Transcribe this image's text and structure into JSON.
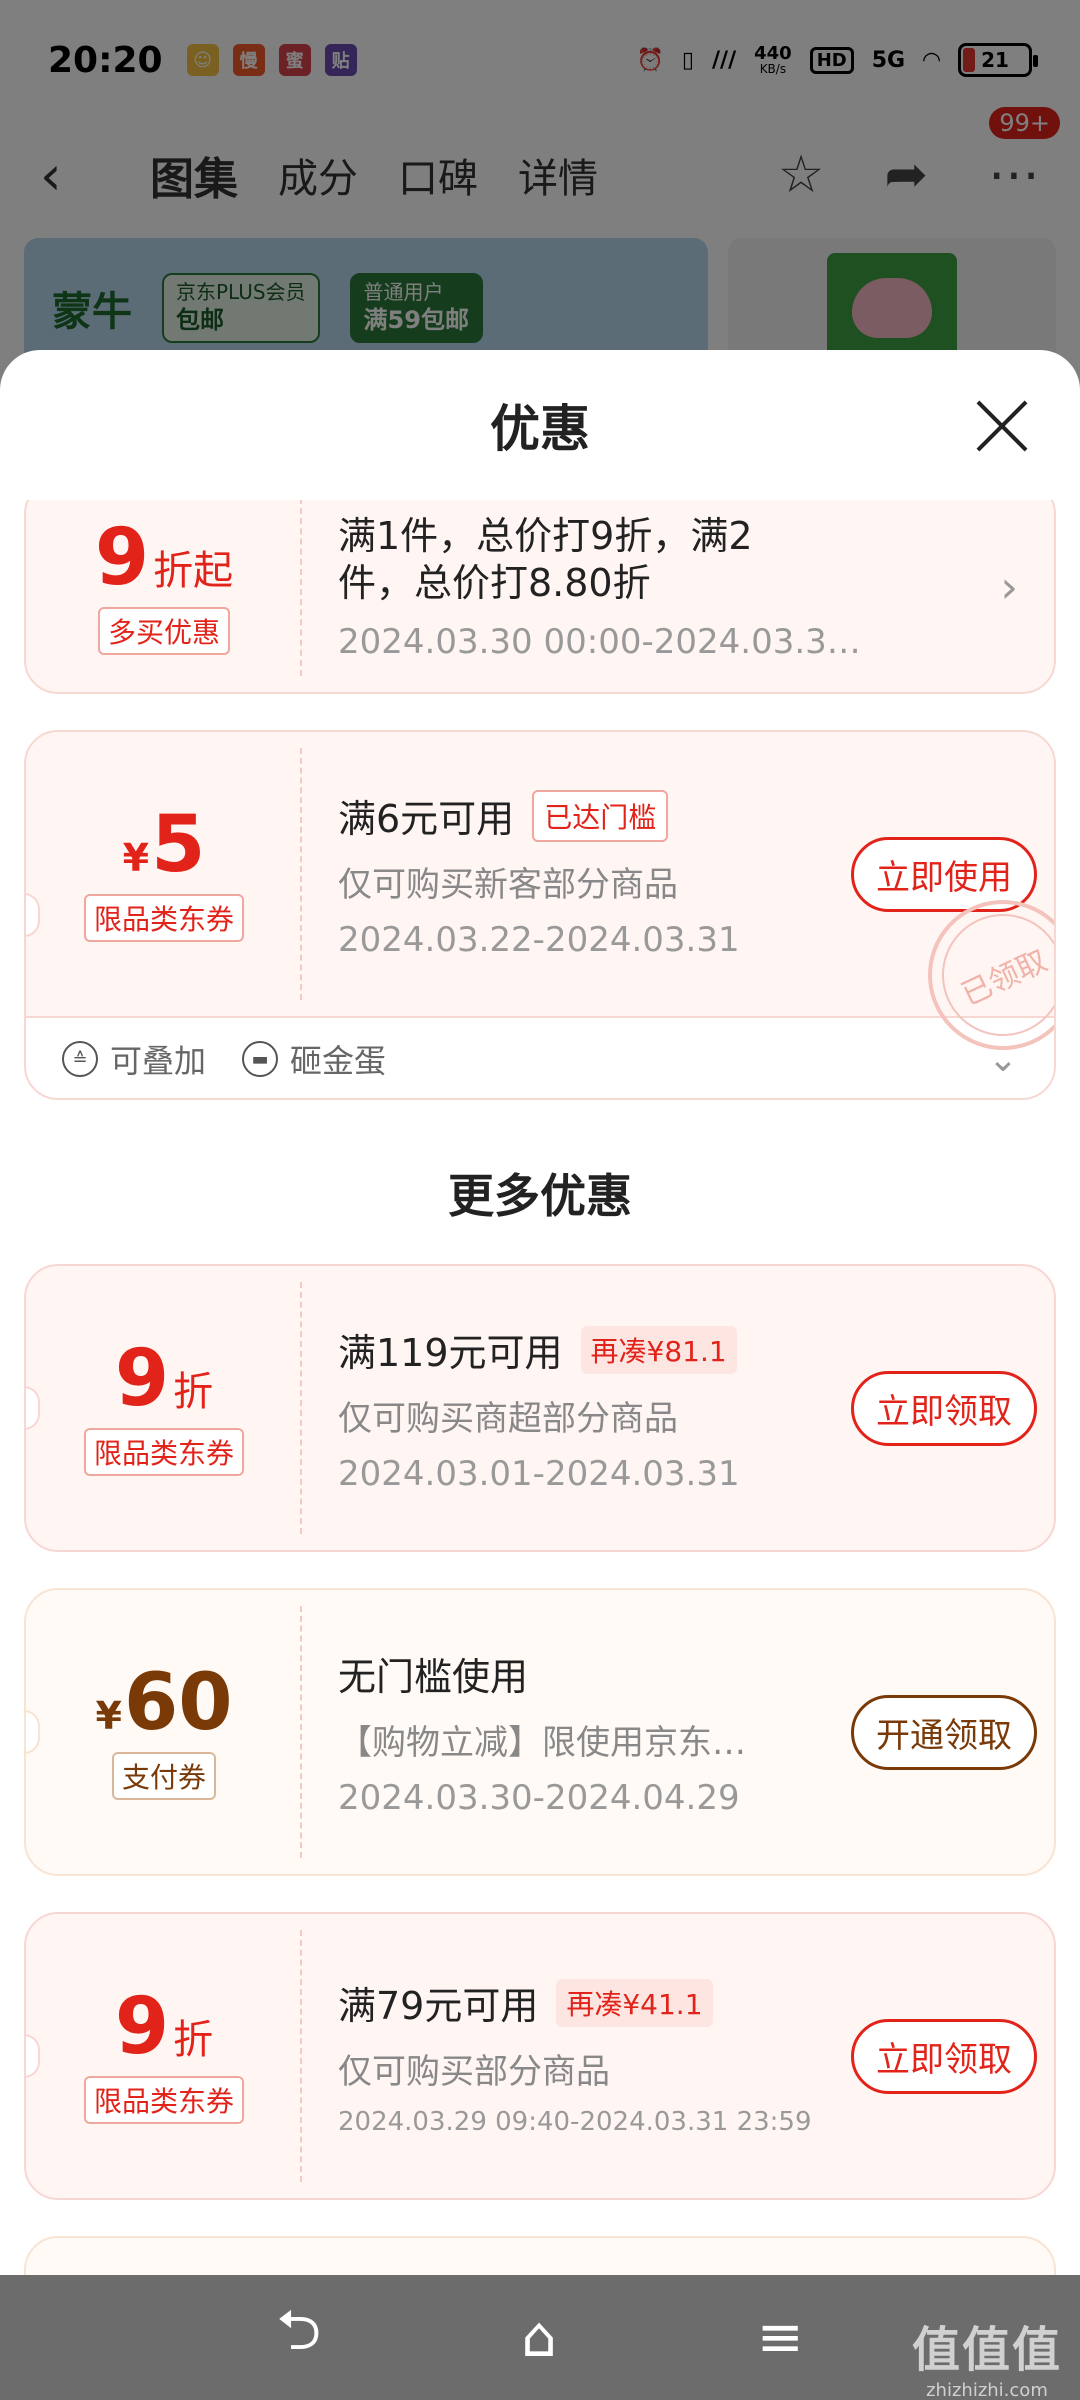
{
  "status": {
    "time": "20:20",
    "apps": [
      {
        "icon": "emoji-app-icon",
        "glyph": "😀",
        "color": "#f6c343"
      },
      {
        "icon": "red-app-icon",
        "glyph": "慢",
        "color": "#f15a29"
      },
      {
        "icon": "pink-app-icon",
        "glyph": "蜜",
        "color": "#d8434d"
      },
      {
        "icon": "purple-app-icon",
        "glyph": "贴",
        "color": "#6b4bb3"
      }
    ],
    "net_speed": "440",
    "net_unit": "KB/s",
    "hd": "HD",
    "network": "5G",
    "battery": "21"
  },
  "nav": {
    "tabs": [
      "图集",
      "成分",
      "口碑",
      "详情"
    ],
    "badge": "99+"
  },
  "banner": {
    "brand": "蒙牛",
    "tag1_top": "京东PLUS会员",
    "tag1_bottom": "包邮",
    "tag2_top": "普通用户",
    "tag2_bottom": "满59包邮"
  },
  "sheet": {
    "title": "优惠",
    "more_title": "更多优惠"
  },
  "coupons": [
    {
      "amount": "9",
      "unit": "折起",
      "type": "多买优惠",
      "cond": "满1件，总价打9折，满2",
      "cond2": "件，总价打8.80折",
      "date": "2024.03.30 00:00-2024.03.3…"
    },
    {
      "currency": "¥",
      "amount": "5",
      "type": "限品类东券",
      "cond": "满6元可用",
      "tag": "已达门槛",
      "desc": "仅可购买新客部分商品",
      "date": "2024.03.22-2024.03.31",
      "button": "立即使用",
      "stamp": "已领取",
      "extras": [
        "可叠加",
        "砸金蛋"
      ]
    },
    {
      "amount": "9",
      "unit": "折",
      "type": "限品类东券",
      "cond": "满119元可用",
      "tag": "再凑¥81.1",
      "desc": "仅可购买商超部分商品",
      "date": "2024.03.01-2024.03.31",
      "button": "立即领取"
    },
    {
      "currency": "¥",
      "amount": "60",
      "type": "支付券",
      "cond": "无门槛使用",
      "desc": "【购物立减】限使用京东…",
      "date": "2024.03.30-2024.04.29",
      "button": "开通领取"
    },
    {
      "amount": "9",
      "unit": "折",
      "type": "限品类东券",
      "cond": "满79元可用",
      "tag": "再凑¥41.1",
      "desc": "仅可购买部分商品",
      "date": "2024.03.29 09:40-2024.03.31 23:59",
      "button": "立即领取"
    }
  ],
  "watermark": {
    "big": "值值值",
    "small": "zhizhizhi.com"
  },
  "colors": {
    "accent": "#e2231a",
    "pay": "#7a3a08"
  }
}
